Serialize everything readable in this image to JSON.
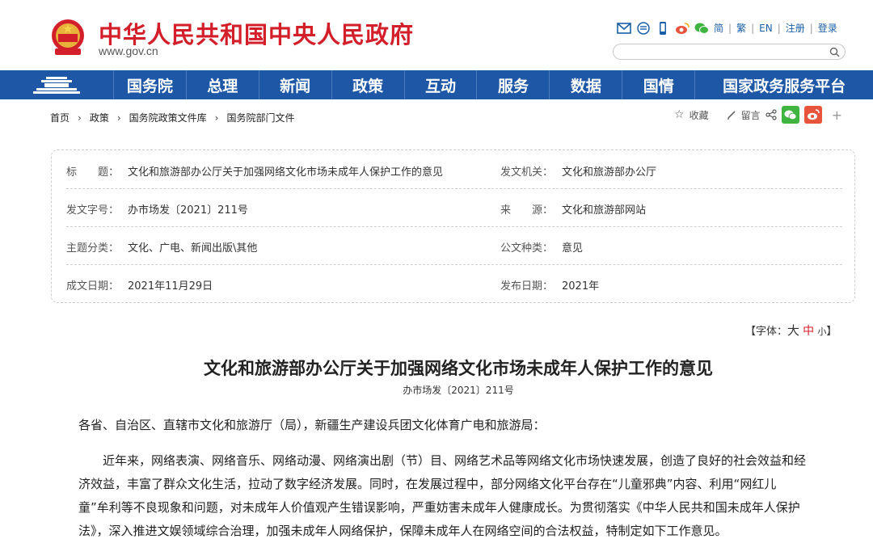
{
  "header": {
    "site_title": "中华人民共和国中央人民政府",
    "site_domain": "www.gov.cn",
    "lang_links": [
      "简",
      "繁",
      "EN"
    ],
    "register": "注册",
    "login": "登录",
    "search_placeholder": ""
  },
  "nav": {
    "items": [
      "国务院",
      "总理",
      "新闻",
      "政策",
      "互动",
      "服务",
      "数据",
      "国情",
      "国家政务服务平台"
    ]
  },
  "breadcrumb": [
    "首页",
    "政策",
    "国务院政策文件库",
    "国务院部门文件"
  ],
  "share": {
    "favorite": "收藏",
    "comment": "留言",
    "plus": "+"
  },
  "info": {
    "title_label": "标　　题：",
    "title_value": "文化和旅游部办公厅关于加强网络文化市场未成年人保护工作的意见",
    "issuer_label": "发文机关：",
    "issuer_value": "文化和旅游部办公厅",
    "docno_label": "发文字号：",
    "docno_value": "办市场发〔2021〕211号",
    "source_label": "来　　源：",
    "source_value": "文化和旅游部网站",
    "topic_label": "主题分类：",
    "topic_value": "文化、广电、新闻出版\\其他",
    "type_label": "公文种类：",
    "type_value": "意见",
    "written_label": "成文日期：",
    "written_value": "2021年11月29日",
    "published_label": "发布日期：",
    "published_value": "2021年"
  },
  "font_size": {
    "prefix": "【字体：",
    "large": "大",
    "medium": "中",
    "small": "小",
    "suffix": "】"
  },
  "article": {
    "title": "文化和旅游部办公厅关于加强网络文化市场未成年人保护工作的意见",
    "doc_number": "办市场发〔2021〕211号",
    "salutation": "各省、自治区、直辖市文化和旅游厅（局），新疆生产建设兵团文化体育广电和旅游局：",
    "lines": [
      "　　近年来，网络表演、网络音乐、网络动漫、网络演出剧（节）目、网络艺术品等网络文化市场快速发展，创造了良好的社会效益和经",
      "济效益，丰富了群众文化生活，拉动了数字经济发展。同时，在发展过程中，部分网络文化平台存在“儿童邪典”内容、利用“网红儿",
      "童”牟利等不良现象和问题，对未成年人价值观产生错误影响，严重妨害未成年人健康成长。为贯彻落实《中华人民共和国未成年人保护",
      "法》，深入推进文娱领域综合治理，加强未成年人网络保护，保障未成年人在网络空间的合法权益，特制定如下工作意见。"
    ]
  },
  "colors": {
    "brand_red": "#d31f2a",
    "nav_blue": "#1e57a6",
    "link_blue": "#1a5fa8",
    "wechat_green": "#3fb440",
    "weibo_red": "#e8533b"
  }
}
